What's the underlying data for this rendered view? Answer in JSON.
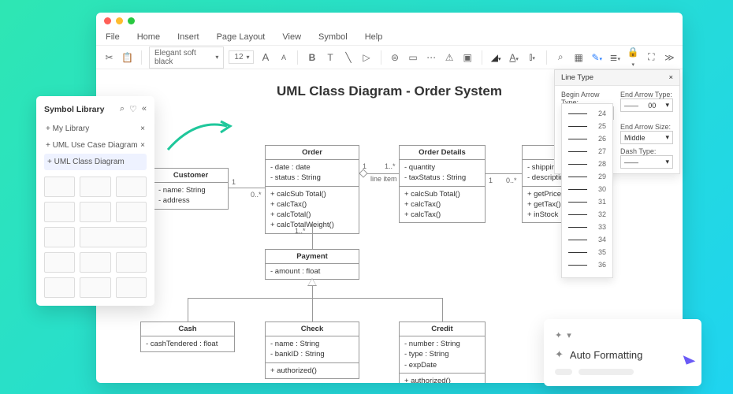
{
  "menubar": {
    "items": [
      "File",
      "Home",
      "Insert",
      "Page Layout",
      "View",
      "Symbol",
      "Help"
    ]
  },
  "toolbar": {
    "font": "Elegant soft black",
    "size": "12"
  },
  "canvas": {
    "title": "UML Class Diagram - Order System",
    "classes": {
      "customer": {
        "name": "Customer",
        "attrs": [
          "- name: String",
          "- address"
        ]
      },
      "order": {
        "name": "Order",
        "attrs": [
          "- date : date",
          "- status : String"
        ],
        "ops": [
          "+ calcSub Total()",
          "+ calcTax()",
          "+ calcTotal()",
          "+ calcTotalWeight()"
        ]
      },
      "orderDetails": {
        "name": "Order Details",
        "attrs": [
          "- quantity",
          "- taxStatus : String"
        ],
        "ops": [
          "+ calcSub Total()",
          "+ calcTax()",
          "+ calcTax()"
        ]
      },
      "partial": {
        "attrs": [
          "- shipping",
          "- descriptio"
        ],
        "ops": [
          "+ getPrice",
          "+ getTax()",
          "+ inStock"
        ]
      },
      "payment": {
        "name": "Payment",
        "attrs": [
          "- amount : float"
        ]
      },
      "cash": {
        "name": "Cash",
        "attrs": [
          "- cashTendered : float"
        ]
      },
      "check": {
        "name": "Check",
        "attrs": [
          "- name : String",
          "- bankID : String"
        ],
        "ops": [
          "+ authorized()"
        ]
      },
      "credit": {
        "name": "Credit",
        "attrs": [
          "- number : String",
          "- type : String",
          "- expDate"
        ],
        "ops": [
          "+ authorized()"
        ]
      }
    },
    "labels": {
      "one1": "1",
      "zeroStar1": "0..*",
      "lineItem": "line item",
      "one2": "1",
      "oneStar": "1..*",
      "one3": "1",
      "zeroStar2": "0..*",
      "oneStar2": "1..*"
    }
  },
  "symbolLibrary": {
    "title": "Symbol Library",
    "items": [
      "My Library",
      "UML Use Case Diagram",
      "UML Class Diagram"
    ],
    "prefix": "+ "
  },
  "lineType": {
    "title": "Line Type",
    "beginArrow": "Begin Arrow Type:",
    "endArrow": "End Arrow Type:",
    "endSize": "End Arrow Size:",
    "dash": "Dash Type:",
    "val00": "00",
    "sizeVal": "Middle",
    "numbers": [
      "24",
      "25",
      "26",
      "27",
      "28",
      "29",
      "30",
      "31",
      "32",
      "33",
      "34",
      "35",
      "36"
    ]
  },
  "autoFormat": {
    "title": "Auto Formatting"
  }
}
